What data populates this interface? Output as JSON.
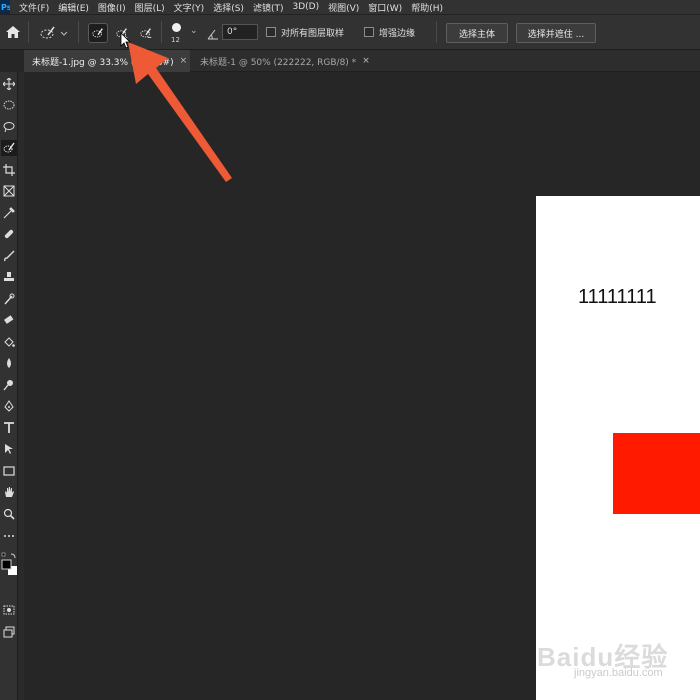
{
  "app": {
    "logo_text": "Ps"
  },
  "menu": {
    "items": [
      {
        "label": "文件(F)"
      },
      {
        "label": "编辑(E)"
      },
      {
        "label": "图像(I)"
      },
      {
        "label": "图层(L)"
      },
      {
        "label": "文字(Y)"
      },
      {
        "label": "选择(S)"
      },
      {
        "label": "滤镜(T)"
      },
      {
        "label": "3D(D)"
      },
      {
        "label": "视图(V)"
      },
      {
        "label": "窗口(W)"
      },
      {
        "label": "帮助(H)"
      }
    ]
  },
  "options": {
    "brush_size": "12",
    "angle_value": "0°",
    "sample_all_layers_label": "对所有图层取样",
    "sample_all_layers_checked": false,
    "enhance_edge_label": "增强边缘",
    "enhance_edge_checked": false,
    "select_subject_label": "选择主体",
    "select_and_mask_label": "选择并遮住 ..."
  },
  "tabs": [
    {
      "label": "未标题-1.jpg @ 33.3% (RGB/8#)",
      "close": "×",
      "active": true
    },
    {
      "label": "未标题-1 @ 50% (222222, RGB/8) *",
      "close": "×",
      "active": false
    }
  ],
  "canvas": {
    "text": "11111111",
    "rect_color": "#ff1a00"
  },
  "watermark": {
    "logo": "Baidu经验",
    "url": "jingyan.baidu.com"
  },
  "colors": {
    "ui_dark": "#262626",
    "panel": "#323232",
    "accent_arrow": "#ee5a36",
    "document_bg": "#ffffff"
  }
}
